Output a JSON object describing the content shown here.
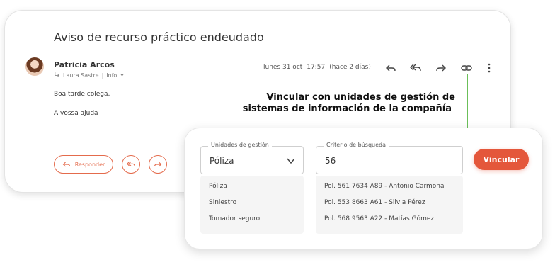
{
  "email": {
    "subject": "Aviso de recurso práctico endeudado",
    "sender": {
      "name": "Patricia Arcos",
      "to": "Laura Sastre",
      "info": "Info"
    },
    "date": "lunes 31 oct",
    "time": "17:57",
    "relative": "(hace 2 días)",
    "body": [
      "Boa tarde colega,",
      "A vossa ajuda"
    ],
    "toolbar_icons": [
      "reply-icon",
      "reply-all-icon",
      "forward-icon",
      "link-icon",
      "more-vertical-icon"
    ],
    "reply_label": "Responder"
  },
  "callout": {
    "line1": "Vincular con unidades de gestión de",
    "line2": "sistemas de información de la compañía",
    "line_color": "#6bbf59"
  },
  "link_panel": {
    "unit_field": {
      "label": "Unidades de gestión",
      "value": "Póliza",
      "options": [
        "Póliza",
        "Siniestro",
        "Tomador seguro"
      ]
    },
    "search_field": {
      "label": "Criterio de búsqueda",
      "value": "56",
      "results": [
        "Pol. 561 7634 A89 - Antonio Carmona",
        "Pol. 553 8663 A61 - Silvia Pérez",
        "Pol. 568 9563 A22 - Matías Gómez"
      ]
    },
    "button_label": "Vincular",
    "accent": "#e4573b"
  }
}
